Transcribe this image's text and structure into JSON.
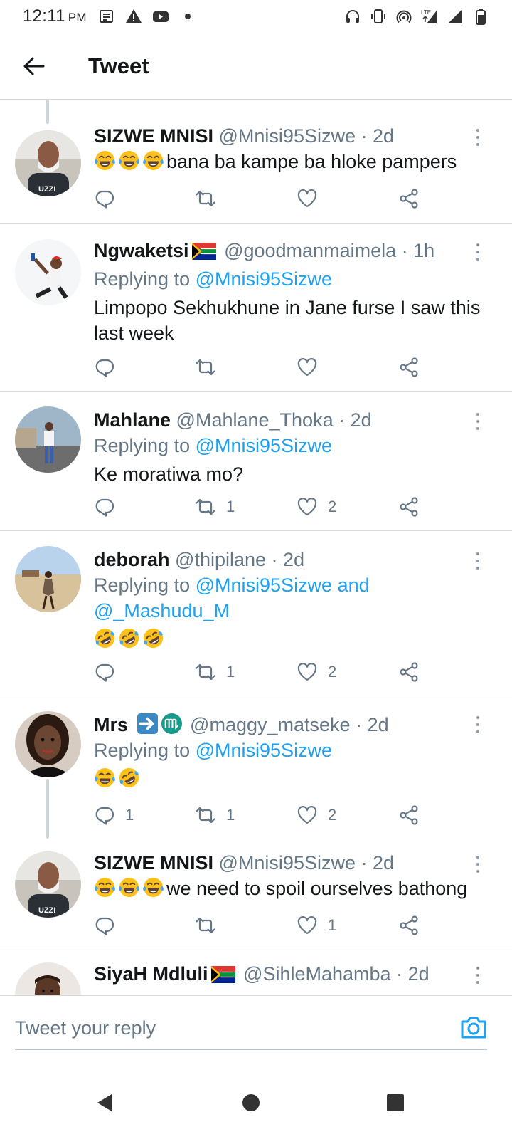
{
  "status_bar": {
    "time": "12:11",
    "ampm": "PM",
    "network_label": "LTE"
  },
  "header": {
    "title": "Tweet"
  },
  "tweets": [
    {
      "name": "SIZWE MNISI",
      "handle": "@Mnisi95Sizwe",
      "time": "· 2d",
      "text": "bana ba kampe ba hloke pampers",
      "emojis": [
        "face-with-tears-of-joy",
        "face-with-tears-of-joy",
        "face-with-tears-of-joy"
      ],
      "reply_count": "",
      "retweet_count": "",
      "like_count": ""
    },
    {
      "name": "Ngwaketsi",
      "flag": "south-africa-flag",
      "handle": "@goodmanmaimela",
      "time": "· 1h",
      "replying_prefix": "Replying to",
      "replying_to": "@Mnisi95Sizwe",
      "text": "Limpopo Sekhukhune in Jane furse I saw this last week",
      "reply_count": "",
      "retweet_count": "",
      "like_count": ""
    },
    {
      "name": "Mahlane",
      "handle": "@Mahlane_Thoka",
      "time": "· 2d",
      "replying_prefix": "Replying to",
      "replying_to": "@Mnisi95Sizwe",
      "text": "Ke moratiwa mo?",
      "reply_count": "",
      "retweet_count": "1",
      "like_count": "2"
    },
    {
      "name": "deborah",
      "handle": "@thipilane",
      "time": "· 2d",
      "replying_prefix": "Replying to",
      "replying_to": "@Mnisi95Sizwe and",
      "replying_to_2": "@_Mashudu_M",
      "text": "",
      "emojis": [
        "rolling-on-the-floor-laughing",
        "rolling-on-the-floor-laughing",
        "rolling-on-the-floor-laughing"
      ],
      "reply_count": "",
      "retweet_count": "1",
      "like_count": "2"
    },
    {
      "name": "Mrs",
      "name_emojis": [
        "right-arrow",
        "scorpio"
      ],
      "handle": "@maggy_matseke",
      "time": "· 2d",
      "replying_prefix": "Replying to",
      "replying_to": "@Mnisi95Sizwe",
      "text": "",
      "emojis": [
        "face-with-tears-of-joy",
        "rolling-on-the-floor-laughing"
      ],
      "reply_count": "1",
      "retweet_count": "1",
      "like_count": "2"
    },
    {
      "name": "SIZWE MNISI",
      "handle": "@Mnisi95Sizwe",
      "time": "· 2d",
      "text": "we need to spoil ourselves bathong",
      "emojis": [
        "face-with-tears-of-joy",
        "face-with-tears-of-joy",
        "face-with-tears-of-joy"
      ],
      "reply_count": "",
      "retweet_count": "",
      "like_count": "1"
    },
    {
      "name": "SiyaH Mdluli",
      "flag": "south-africa-flag",
      "handle": "@SihleMahamba",
      "time": "· 2d"
    }
  ],
  "composer": {
    "placeholder": "Tweet your reply"
  },
  "colors": {
    "accent": "#1da1f2",
    "secondary_text": "#657786",
    "divider": "#d6d9dc"
  }
}
